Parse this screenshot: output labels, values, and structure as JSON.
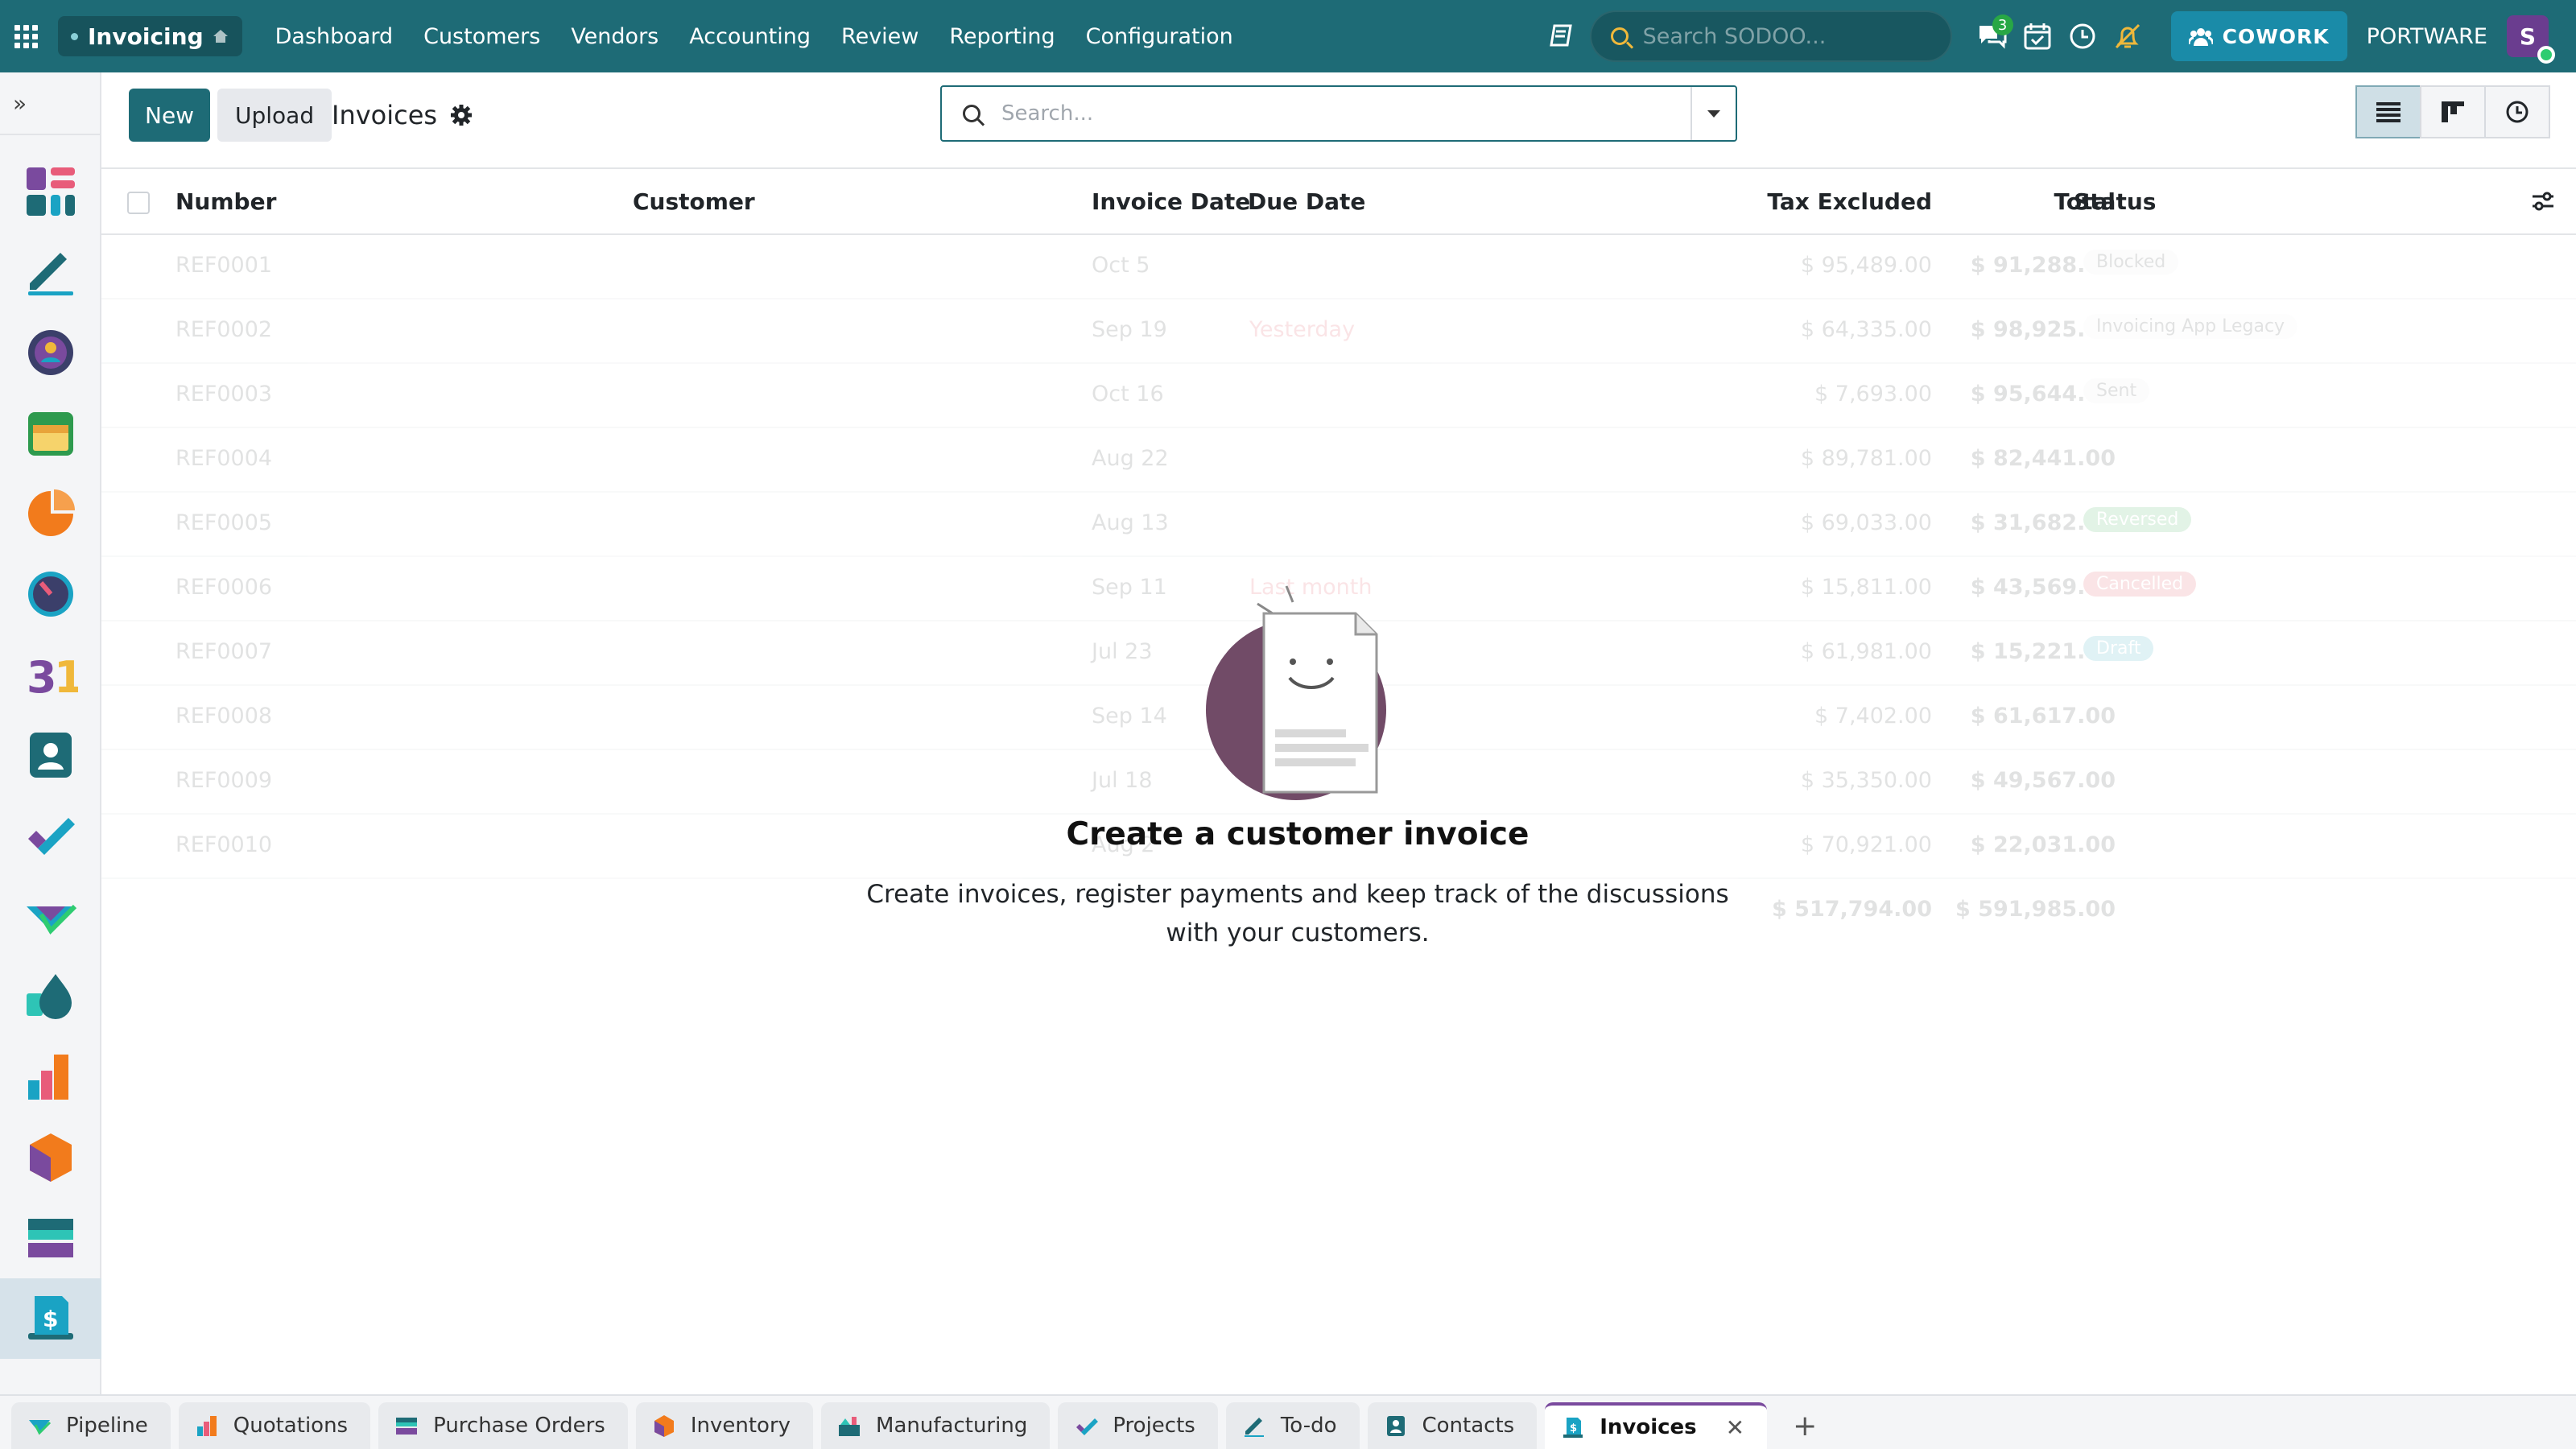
{
  "theme": {
    "brand": "#1e6b76",
    "accent_purple": "#7a4a9e",
    "badge_green": "#28a745"
  },
  "navbar": {
    "app_name": "Invoicing",
    "menu": [
      "Dashboard",
      "Customers",
      "Vendors",
      "Accounting",
      "Review",
      "Reporting",
      "Configuration"
    ],
    "search_placeholder": "Search SODOO...",
    "messages_badge": "3",
    "cowork_label": "COWORK",
    "company": "PORTWARE",
    "avatar_initial": "S"
  },
  "sidebar": {
    "apps": [
      "dashboard",
      "sign",
      "discuss",
      "calendar",
      "crm",
      "timesheets",
      "calendar-31",
      "contacts",
      "projects",
      "pipeline",
      "inventory-drop",
      "reporting",
      "inventory-box",
      "purchase",
      "invoicing"
    ]
  },
  "control": {
    "new_label": "New",
    "upload_label": "Upload",
    "title": "Invoices",
    "search_placeholder": "Search..."
  },
  "columns": {
    "number": "Number",
    "customer": "Customer",
    "invoice_date": "Invoice Date",
    "due_date": "Due Date",
    "tax_excluded": "Tax Excluded",
    "total": "Total",
    "status": "Status"
  },
  "rows": [
    {
      "number": "REF0001",
      "invoice_date": "Oct 5",
      "due_date": "",
      "tax": "$ 95,489.00",
      "total": "$ 91,288.00",
      "status": "Blocked",
      "status_class": "blocked"
    },
    {
      "number": "REF0002",
      "invoice_date": "Sep 19",
      "due_date": "Yesterday",
      "tax": "$ 64,335.00",
      "total": "$ 98,925.00",
      "status": "Invoicing App Legacy",
      "status_class": "legacy"
    },
    {
      "number": "REF0003",
      "invoice_date": "Oct 16",
      "due_date": "",
      "tax": "$ 7,693.00",
      "total": "$ 95,644.00",
      "status": "Sent",
      "status_class": "sent"
    },
    {
      "number": "REF0004",
      "invoice_date": "Aug 22",
      "due_date": "",
      "tax": "$ 89,781.00",
      "total": "$ 82,441.00",
      "status": "",
      "status_class": ""
    },
    {
      "number": "REF0005",
      "invoice_date": "Aug 13",
      "due_date": "",
      "tax": "$ 69,033.00",
      "total": "$ 31,682.00",
      "status": "Reversed",
      "status_class": "reversed"
    },
    {
      "number": "REF0006",
      "invoice_date": "Sep 11",
      "due_date": "Last month",
      "tax": "$ 15,811.00",
      "total": "$ 43,569.00",
      "status": "Cancelled",
      "status_class": "cancelled"
    },
    {
      "number": "REF0007",
      "invoice_date": "Jul 23",
      "due_date": "",
      "tax": "$ 61,981.00",
      "total": "$ 15,221.00",
      "status": "Draft",
      "status_class": "draft"
    },
    {
      "number": "REF0008",
      "invoice_date": "Sep 14",
      "due_date": "",
      "tax": "$ 7,402.00",
      "total": "$ 61,617.00",
      "status": "",
      "status_class": ""
    },
    {
      "number": "REF0009",
      "invoice_date": "Jul 18",
      "due_date": "",
      "tax": "$ 35,350.00",
      "total": "$ 49,567.00",
      "status": "",
      "status_class": ""
    },
    {
      "number": "REF0010",
      "invoice_date": "Aug 2",
      "due_date": "",
      "tax": "$ 70,921.00",
      "total": "$ 22,031.00",
      "status": "",
      "status_class": ""
    }
  ],
  "totals": {
    "tax": "$ 517,794.00",
    "total": "$ 591,985.00"
  },
  "help": {
    "title": "Create a customer invoice",
    "text": "Create invoices, register payments and keep track of the discussions with your customers."
  },
  "tabs": [
    {
      "label": "Pipeline",
      "icon": "pipeline-icon"
    },
    {
      "label": "Quotations",
      "icon": "quotations-icon"
    },
    {
      "label": "Purchase Orders",
      "icon": "purchase-icon"
    },
    {
      "label": "Inventory",
      "icon": "inventory-icon"
    },
    {
      "label": "Manufacturing",
      "icon": "manufacturing-icon"
    },
    {
      "label": "Projects",
      "icon": "projects-icon"
    },
    {
      "label": "To-do",
      "icon": "todo-icon"
    },
    {
      "label": "Contacts",
      "icon": "contacts-icon"
    },
    {
      "label": "Invoices",
      "icon": "invoices-icon",
      "active": true
    }
  ]
}
